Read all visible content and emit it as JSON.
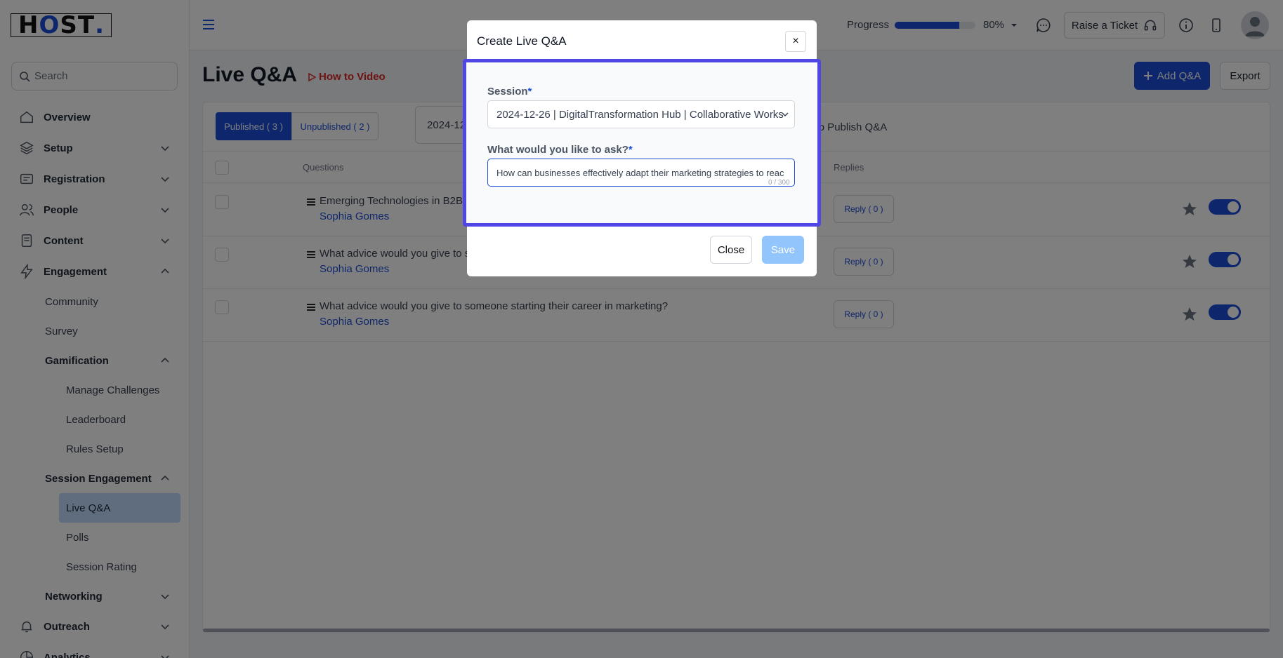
{
  "brand": {
    "logo_text_h": "H",
    "logo_text_o": "O",
    "logo_text_st": "ST",
    "logo_dot": "."
  },
  "sidebar": {
    "search_placeholder": "Search",
    "items": [
      {
        "label": "Overview"
      },
      {
        "label": "Setup"
      },
      {
        "label": "Registration"
      },
      {
        "label": "People"
      },
      {
        "label": "Content"
      },
      {
        "label": "Engagement"
      }
    ],
    "engagement_sub": {
      "community": "Community",
      "survey": "Survey",
      "gamification": "Gamification",
      "manage_challenges": "Manage Challenges",
      "leaderboard": "Leaderboard",
      "rules_setup": "Rules Setup",
      "session_engagement": "Session Engagement",
      "live_qa": "Live Q&A",
      "polls": "Polls",
      "session_rating": "Session Rating",
      "networking": "Networking"
    },
    "outreach": "Outreach",
    "analytics": "Analytics"
  },
  "header": {
    "progress_label": "Progress",
    "progress_value": "80%",
    "progress_fraction": 0.8,
    "ticket_label": "Raise a Ticket"
  },
  "main": {
    "title": "Live Q&A",
    "how_to": "How to Video",
    "add_button": "Add Q&A",
    "export_button": "Export",
    "tab_published": "Published ( 3 )",
    "tab_unpublished": "Unpublished ( 2 )",
    "filter_value": "2024-12-",
    "publish_hint": "a to Publish Q&A",
    "columns": {
      "questions": "Questions",
      "replies": "Replies"
    },
    "rows": [
      {
        "question": "Emerging Technologies in B2B:",
        "author": "Sophia Gomes",
        "reply": "Reply ( 0 )"
      },
      {
        "question": "What advice would you give to s",
        "author": "Sophia Gomes",
        "reply": "Reply ( 0 )"
      },
      {
        "question": "What advice would you give to someone starting their career in marketing?",
        "author": "Sophia Gomes",
        "reply": "Reply ( 0 )"
      }
    ]
  },
  "modal": {
    "title": "Create Live Q&A",
    "close_x": "×",
    "session_label": "Session",
    "required_mark": "*",
    "session_value": "2024-12-26 | DigitalTransformation Hub | Collaborative Works",
    "question_label": "What would you like to ask?",
    "question_value": "How can businesses effectively adapt their marketing strategies to reac",
    "counter": "0 / 300",
    "close_button": "Close",
    "save_button": "Save"
  },
  "colors": {
    "accent": "#1d4ed8",
    "modal_highlight": "#4f46e5",
    "save_disabled": "#93c5fd"
  }
}
